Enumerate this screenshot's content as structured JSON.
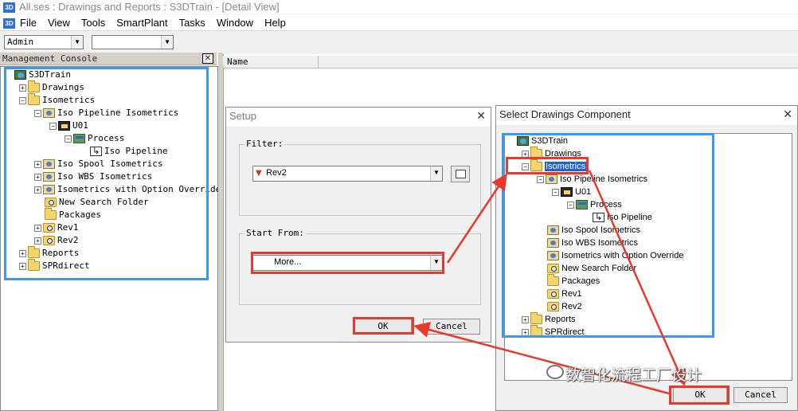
{
  "window": {
    "title": "All.ses : Drawings and Reports : S3DTrain - [Detail View]",
    "icon_label": "3D"
  },
  "menu": [
    "File",
    "View",
    "Tools",
    "SmartPlant",
    "Tasks",
    "Window",
    "Help"
  ],
  "toolbar": {
    "combo1_value": "Admin",
    "combo2_value": ""
  },
  "console": {
    "title": "Management Console",
    "tree": [
      {
        "label": "S3DTrain",
        "icon": "root-icon",
        "indent": 0,
        "expander": "none"
      },
      {
        "label": "Drawings",
        "icon": "folder-icon",
        "indent": 1,
        "expander": "+"
      },
      {
        "label": "Isometrics",
        "icon": "folder-icon",
        "indent": 1,
        "expander": "-"
      },
      {
        "label": "Iso Pipeline Isometrics",
        "icon": "iso-icon",
        "indent": 2,
        "expander": "-"
      },
      {
        "label": "U01",
        "icon": "unit-icon",
        "indent": 3,
        "expander": "-"
      },
      {
        "label": "Process",
        "icon": "process-icon",
        "indent": 4,
        "expander": "-"
      },
      {
        "label": "Iso Pipeline",
        "icon": "pipeline-icon",
        "indent": 5,
        "expander": "none"
      },
      {
        "label": "Iso Spool Isometrics",
        "icon": "iso-icon",
        "indent": 2,
        "expander": "+"
      },
      {
        "label": "Iso WBS Isometrics",
        "icon": "iso-icon",
        "indent": 2,
        "expander": "+"
      },
      {
        "label": "Isometrics with Option Override",
        "icon": "iso-icon",
        "indent": 2,
        "expander": "+"
      },
      {
        "label": "New Search Folder",
        "icon": "search-folder-icon",
        "indent": 2,
        "expander": "none"
      },
      {
        "label": "Packages",
        "icon": "folder-icon",
        "indent": 2,
        "expander": "none"
      },
      {
        "label": "Rev1",
        "icon": "search-folder-icon",
        "indent": 2,
        "expander": "+"
      },
      {
        "label": "Rev2",
        "icon": "search-folder-icon",
        "indent": 2,
        "expander": "+"
      },
      {
        "label": "Reports",
        "icon": "folder-icon",
        "indent": 1,
        "expander": "+"
      },
      {
        "label": "SPRdirect",
        "icon": "folder-icon",
        "indent": 1,
        "expander": "+"
      }
    ]
  },
  "detail": {
    "column_name": "Name"
  },
  "setup": {
    "title": "Setup",
    "filter_label": "Filter:",
    "filter_value": "Rev2",
    "start_from_label": "Start From:",
    "start_from_value": "More...",
    "ok_label": "OK",
    "cancel_label": "Cancel"
  },
  "select_dialog": {
    "title": "Select Drawings Component",
    "tree": [
      {
        "label": "S3DTrain",
        "icon": "root-icon",
        "indent": 0,
        "expander": "none"
      },
      {
        "label": "Drawings",
        "icon": "folder-icon",
        "indent": 1,
        "expander": "+"
      },
      {
        "label": "Isometrics",
        "icon": "folder-icon",
        "indent": 1,
        "expander": "-",
        "selected": true
      },
      {
        "label": "Iso Pipeline Isometrics",
        "icon": "iso-icon",
        "indent": 2,
        "expander": "-"
      },
      {
        "label": "U01",
        "icon": "unit-icon",
        "indent": 3,
        "expander": "-"
      },
      {
        "label": "Process",
        "icon": "process-icon",
        "indent": 4,
        "expander": "-"
      },
      {
        "label": "Iso Pipeline",
        "icon": "pipeline-icon",
        "indent": 5,
        "expander": "none"
      },
      {
        "label": "Iso Spool Isometrics",
        "icon": "iso-icon",
        "indent": 2,
        "expander": "none"
      },
      {
        "label": "Iso WBS Isometrics",
        "icon": "iso-icon",
        "indent": 2,
        "expander": "none"
      },
      {
        "label": "Isometrics with Option Override",
        "icon": "iso-icon",
        "indent": 2,
        "expander": "none"
      },
      {
        "label": "New Search Folder",
        "icon": "search-folder-icon",
        "indent": 2,
        "expander": "none"
      },
      {
        "label": "Packages",
        "icon": "folder-icon",
        "indent": 2,
        "expander": "none"
      },
      {
        "label": "Rev1",
        "icon": "search-folder-icon",
        "indent": 2,
        "expander": "none"
      },
      {
        "label": "Rev2",
        "icon": "search-folder-icon",
        "indent": 2,
        "expander": "none"
      },
      {
        "label": "Reports",
        "icon": "folder-icon",
        "indent": 1,
        "expander": "+"
      },
      {
        "label": "SPRdirect",
        "icon": "folder-icon",
        "indent": 1,
        "expander": "+"
      }
    ],
    "ok_label": "OK",
    "cancel_label": "Cancel"
  },
  "watermark": {
    "text": "数智化流程工厂设计"
  },
  "colors": {
    "highlight_blue": "#3a98f0",
    "annotation_red": "#e8392a",
    "selection": "#1e63d8"
  }
}
